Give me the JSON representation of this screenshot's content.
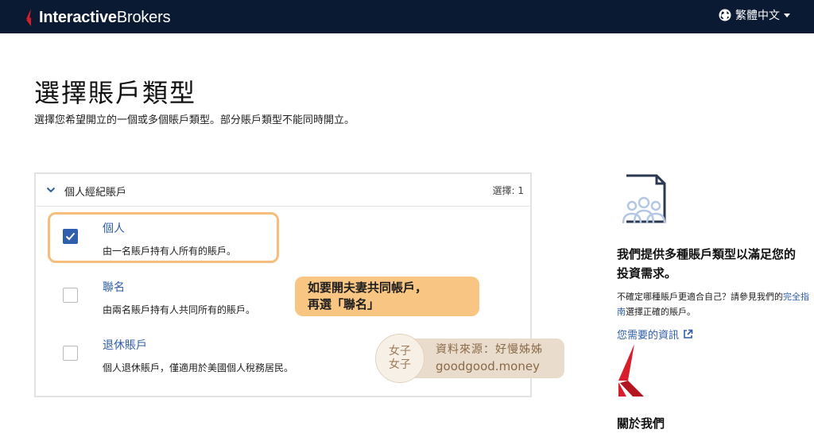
{
  "header": {
    "logo_bold": "Interactive",
    "logo_light": "Brokers",
    "language": "繁體中文",
    "globe_icon": "globe-icon",
    "colors": {
      "bar": "#0b1a33",
      "logo_red": "#d81e2c"
    }
  },
  "page": {
    "title": "選擇賬戶類型",
    "subtitle": "選擇您希望開立的一個或多個賬戶類型。部分賬戶類型不能同時開立。"
  },
  "panel": {
    "title": "個人經紀賬戶",
    "count": "選擇: 1",
    "options": [
      {
        "label": "個人",
        "description": "由一名賬戶持有人所有的賬戶。",
        "checked": true
      },
      {
        "label": "聯名",
        "description": "由兩名賬戶持有人共同所有的賬戶。",
        "checked": false
      },
      {
        "label": "退休賬戶",
        "description": "個人退休賬戶，僅適用於美國個人稅務居民。",
        "checked": false
      }
    ]
  },
  "callout": {
    "line1": "如要開夫妻共同帳戶，",
    "line2": "再選「聯名」"
  },
  "watermark": {
    "seal_top": "女子",
    "seal_bottom": "女子",
    "line1": "資料來源：好慢姊姊",
    "line2": "goodgood.money"
  },
  "sidebar": {
    "heading": "我們提供多種賬戶類型以滿足您的投資需求。",
    "text_before": "不確定哪種賬戶更適合自己？請參見我們的",
    "text_link": "完全指南",
    "text_after": "選擇正確的賬戶。",
    "info_link": "您需要的資訊",
    "about": "關於我們"
  },
  "colors": {
    "accent": "#2d5da8",
    "checkbox": "#2f5fac",
    "highlight": "#f6bd7c",
    "callout": "#f8c582"
  }
}
